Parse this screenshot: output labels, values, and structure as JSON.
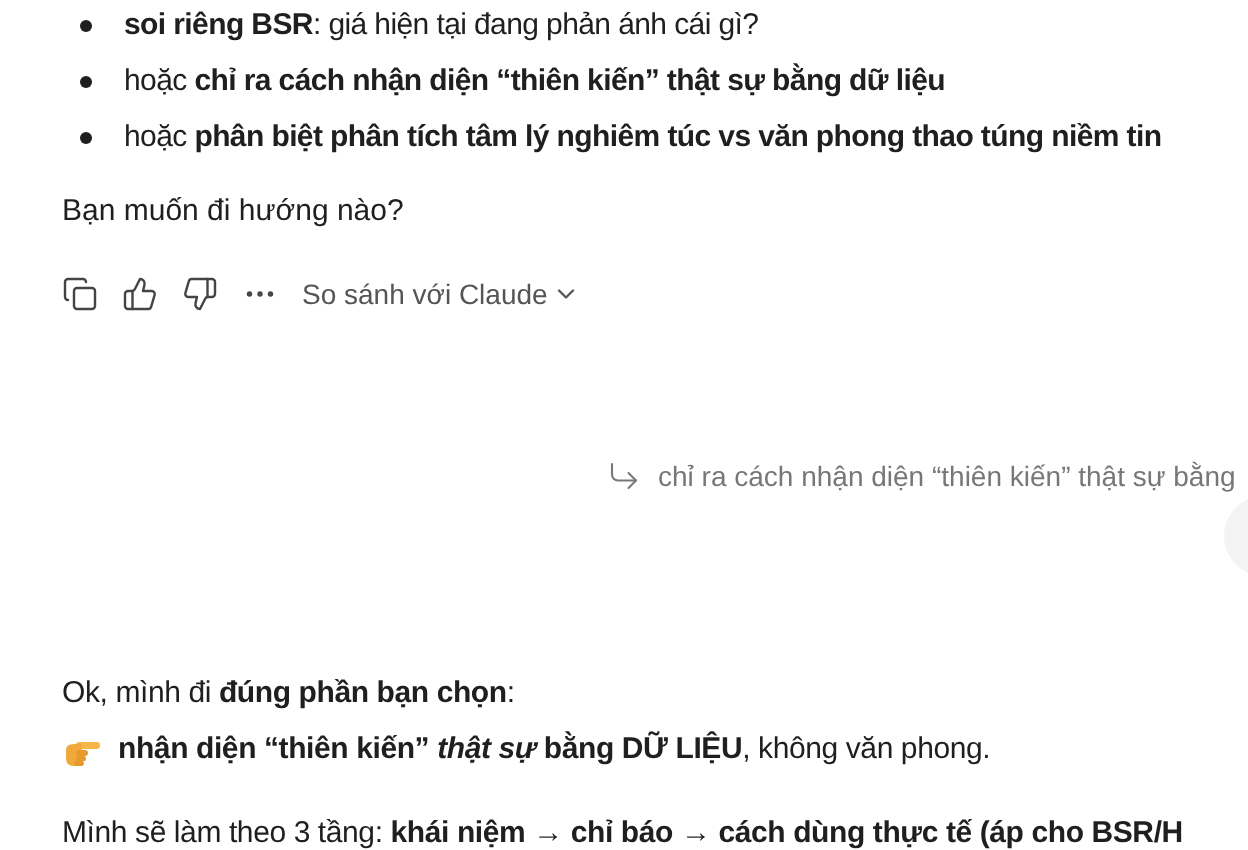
{
  "previous_reply": {
    "bullets": [
      {
        "text": "**soi riêng BSR**: giá hiện tại đang phản ánh cái gì?"
      },
      {
        "text": "hoặc **chỉ ra cách nhận diện “thiên kiến” thật sự bằng dữ liệu**"
      },
      {
        "text": "hoặc **phân biệt phân tích tâm lý nghiêm túc vs văn phong thao túng niềm tin**"
      }
    ],
    "question": "Bạn muốn đi hướng nào?",
    "actions": {
      "compare_label": "So sánh với Claude"
    }
  },
  "user_quote": {
    "text": "chỉ ra cách nhận diện “thiên kiến” thật sự bằng"
  },
  "reply": {
    "paragraphs": [
      {
        "kind": "plain",
        "text": "Ok, mình đi **đúng phần bạn chọn**:"
      },
      {
        "kind": "pointer",
        "text": "**nhận diện “thiên kiến” *thật sự* bằng DỮ LIỆU**, không văn phong."
      },
      {
        "kind": "plain",
        "text": "Mình sẽ làm theo 3 tầng: **khái niệm → chỉ báo → cách dùng thực tế (áp cho BSR/H**"
      }
    ]
  }
}
